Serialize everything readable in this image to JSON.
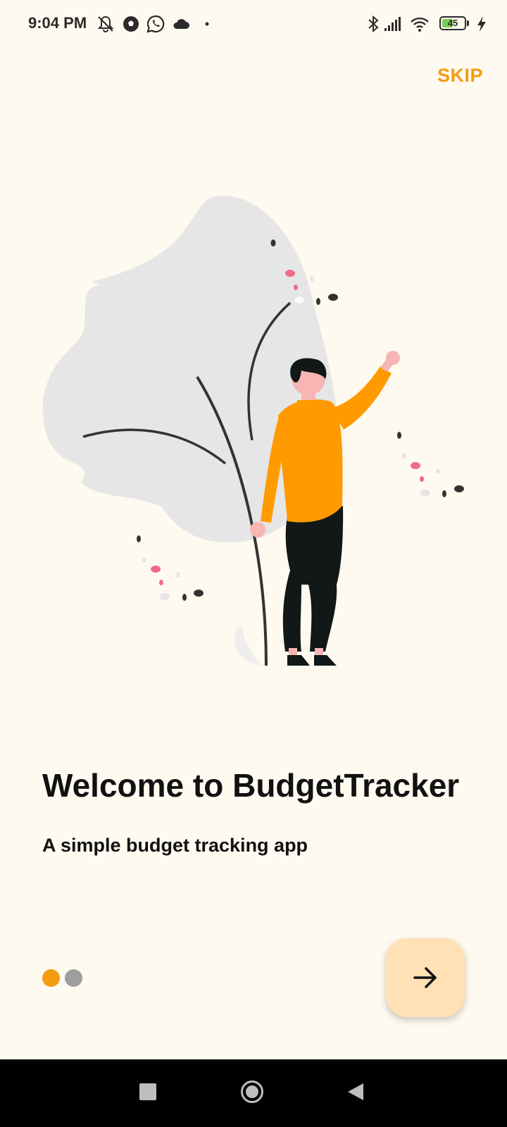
{
  "status_bar": {
    "time": "9:04 PM",
    "battery_level": "45",
    "icons": [
      "mute-bell-icon",
      "soccer-ball-icon",
      "whatsapp-icon",
      "cloud-icon",
      "dot-icon",
      "bluetooth-icon",
      "signal-icon",
      "wifi-icon",
      "battery-icon",
      "charging-icon"
    ]
  },
  "header": {
    "skip_label": "SKIP"
  },
  "onboarding": {
    "title": "Welcome to BudgetTracker",
    "subtitle": "A simple budget tracking app",
    "illustration": "person-waving-with-plant-illustration"
  },
  "page_indicator": {
    "total": 2,
    "current": 1,
    "active_color": "#f39c12",
    "inactive_color": "#9e9e9e"
  },
  "next_button": {
    "icon": "arrow-right-icon",
    "color": "#ffe1b5"
  },
  "nav_bar": {
    "icons": [
      "recents-square-icon",
      "home-circle-icon",
      "back-triangle-icon"
    ]
  },
  "colors": {
    "background": "#fffaf0",
    "accent": "#f39c12"
  }
}
